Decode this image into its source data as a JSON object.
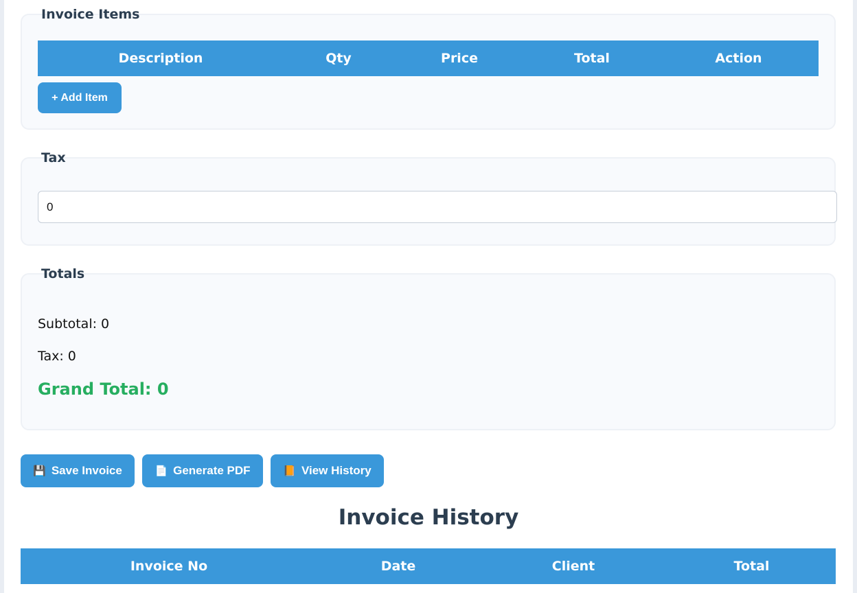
{
  "invoice_items": {
    "legend": "Invoice Items",
    "columns": [
      "Description",
      "Qty",
      "Price",
      "Total",
      "Action"
    ],
    "add_item_label": "+ Add Item"
  },
  "tax": {
    "legend": "Tax",
    "value": "0"
  },
  "totals": {
    "legend": "Totals",
    "subtotal_text": "Subtotal: 0",
    "tax_text": "Tax: 0",
    "grand_total_text": "Grand Total: 0"
  },
  "actions": {
    "save_label": "Save Invoice",
    "save_icon": "💾",
    "pdf_label": "Generate PDF",
    "pdf_icon": "📄",
    "history_label": "View History",
    "history_icon": "📙"
  },
  "history": {
    "title": "Invoice History",
    "columns": [
      "Invoice No",
      "Date",
      "Client",
      "Total"
    ]
  },
  "colors": {
    "accent": "#3a98da",
    "grand_total": "#27ae60",
    "heading": "#2c3e50"
  }
}
